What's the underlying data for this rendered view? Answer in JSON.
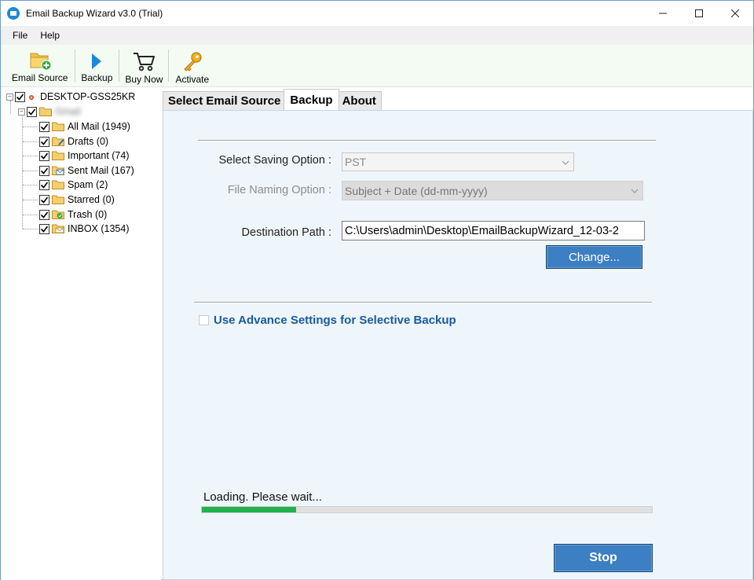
{
  "window": {
    "title": "Email Backup Wizard v3.0 (Trial)",
    "controls": {
      "minimize": "minimize-icon",
      "maximize": "maximize-icon",
      "close": "close-icon"
    }
  },
  "menu": {
    "items": [
      "File",
      "Help"
    ]
  },
  "toolbar": {
    "email_source": "Email Source",
    "backup": "Backup",
    "buy_now": "Buy Now",
    "activate": "Activate"
  },
  "tree": {
    "root": "DESKTOP-GSS25KR",
    "account": "Gmail",
    "folders": [
      {
        "label": "All Mail (1949)",
        "icon": "folder-icon"
      },
      {
        "label": "Drafts (0)",
        "icon": "drafts-folder-icon"
      },
      {
        "label": "Important (74)",
        "icon": "folder-icon"
      },
      {
        "label": "Sent Mail (167)",
        "icon": "sent-folder-icon"
      },
      {
        "label": "Spam (2)",
        "icon": "folder-icon"
      },
      {
        "label": "Starred (0)",
        "icon": "folder-icon"
      },
      {
        "label": "Trash (0)",
        "icon": "trash-folder-icon"
      },
      {
        "label": "INBOX (1354)",
        "icon": "inbox-folder-icon"
      }
    ]
  },
  "tabs": [
    {
      "label": "Select Email Source",
      "active": false
    },
    {
      "label": "Backup",
      "active": true
    },
    {
      "label": "About",
      "active": false
    }
  ],
  "backup": {
    "saving_option_label": "Select Saving Option :",
    "saving_option_value": "PST",
    "file_naming_label": "File Naming Option :",
    "file_naming_value": "Subject + Date (dd-mm-yyyy)",
    "destination_label": "Destination Path :",
    "destination_value": "C:\\Users\\admin\\Desktop\\EmailBackupWizard_12-03-2",
    "change_button": "Change...",
    "advance_settings_label": "Use Advance Settings for Selective Backup",
    "status_text": "Loading. Please wait...",
    "progress_fraction": 0.21,
    "stop_button": "Stop"
  },
  "colors": {
    "accent_blue": "#3d7fc3",
    "progress_green": "#22b14c",
    "panel_bg": "#eef6fb",
    "toolbar_bg": "#f3fbf3",
    "link_blue": "#1a5a9c"
  }
}
